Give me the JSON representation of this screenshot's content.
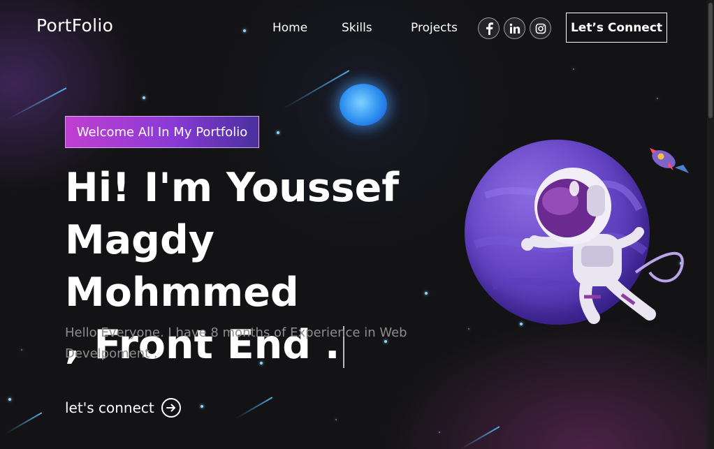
{
  "brand": {
    "logo_text": "PortFolio"
  },
  "nav": {
    "links": [
      "Home",
      "Skills",
      "Projects"
    ],
    "social_icons": [
      "facebook-icon",
      "linkedin-icon",
      "instagram-icon"
    ],
    "connect_label": "Let’s Connect"
  },
  "hero": {
    "tagline": "Welcome All In My Portfolio",
    "headline_line1": "Hi! I'm Youssef",
    "headline_line2": "Magdy Mohmmed",
    "headline_line3": ", Front End .",
    "intro": "Hello Everyone. I have 8 months of Experience in Web Develpoment .",
    "cta_label": "let's connect"
  },
  "colors": {
    "background": "#131315",
    "accent_gradient_start": "#c03fd0",
    "accent_gradient_end": "#4a2f9e",
    "muted_text": "#8d8d8d",
    "planet": "#6a48c8"
  }
}
